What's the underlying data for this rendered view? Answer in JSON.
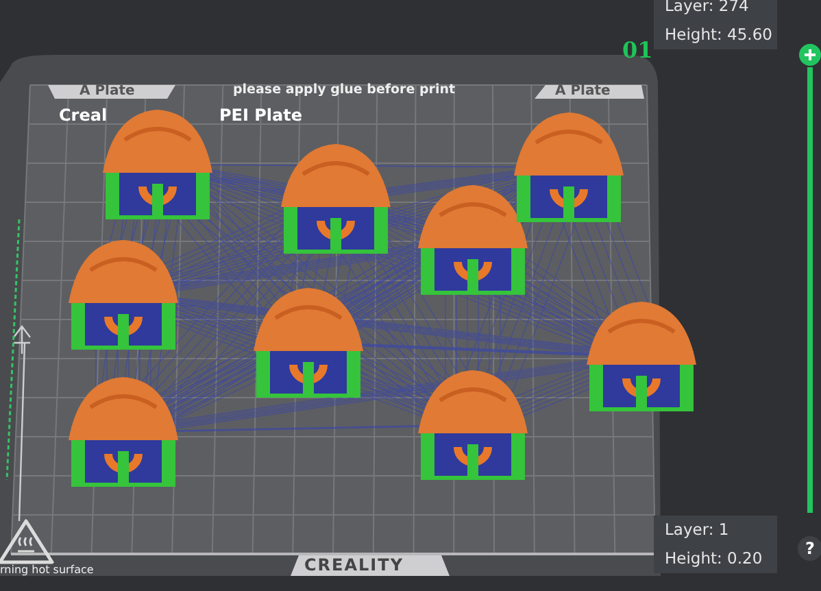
{
  "plate": {
    "tabs": [
      {
        "label": "A Plate"
      },
      {
        "label": "A Plate"
      }
    ],
    "notice": "please apply glue before print",
    "name_parts": [
      "Creal",
      "PEI Plate"
    ],
    "brand": "CREALITY",
    "warning": "rning hot surface"
  },
  "layer_slider": {
    "marker": "01",
    "top": {
      "layer": "Layer: 274",
      "height": "Height: 45.60"
    },
    "bottom": {
      "layer": "Layer: 1",
      "height": "Height: 0.20"
    }
  },
  "help": "?"
}
